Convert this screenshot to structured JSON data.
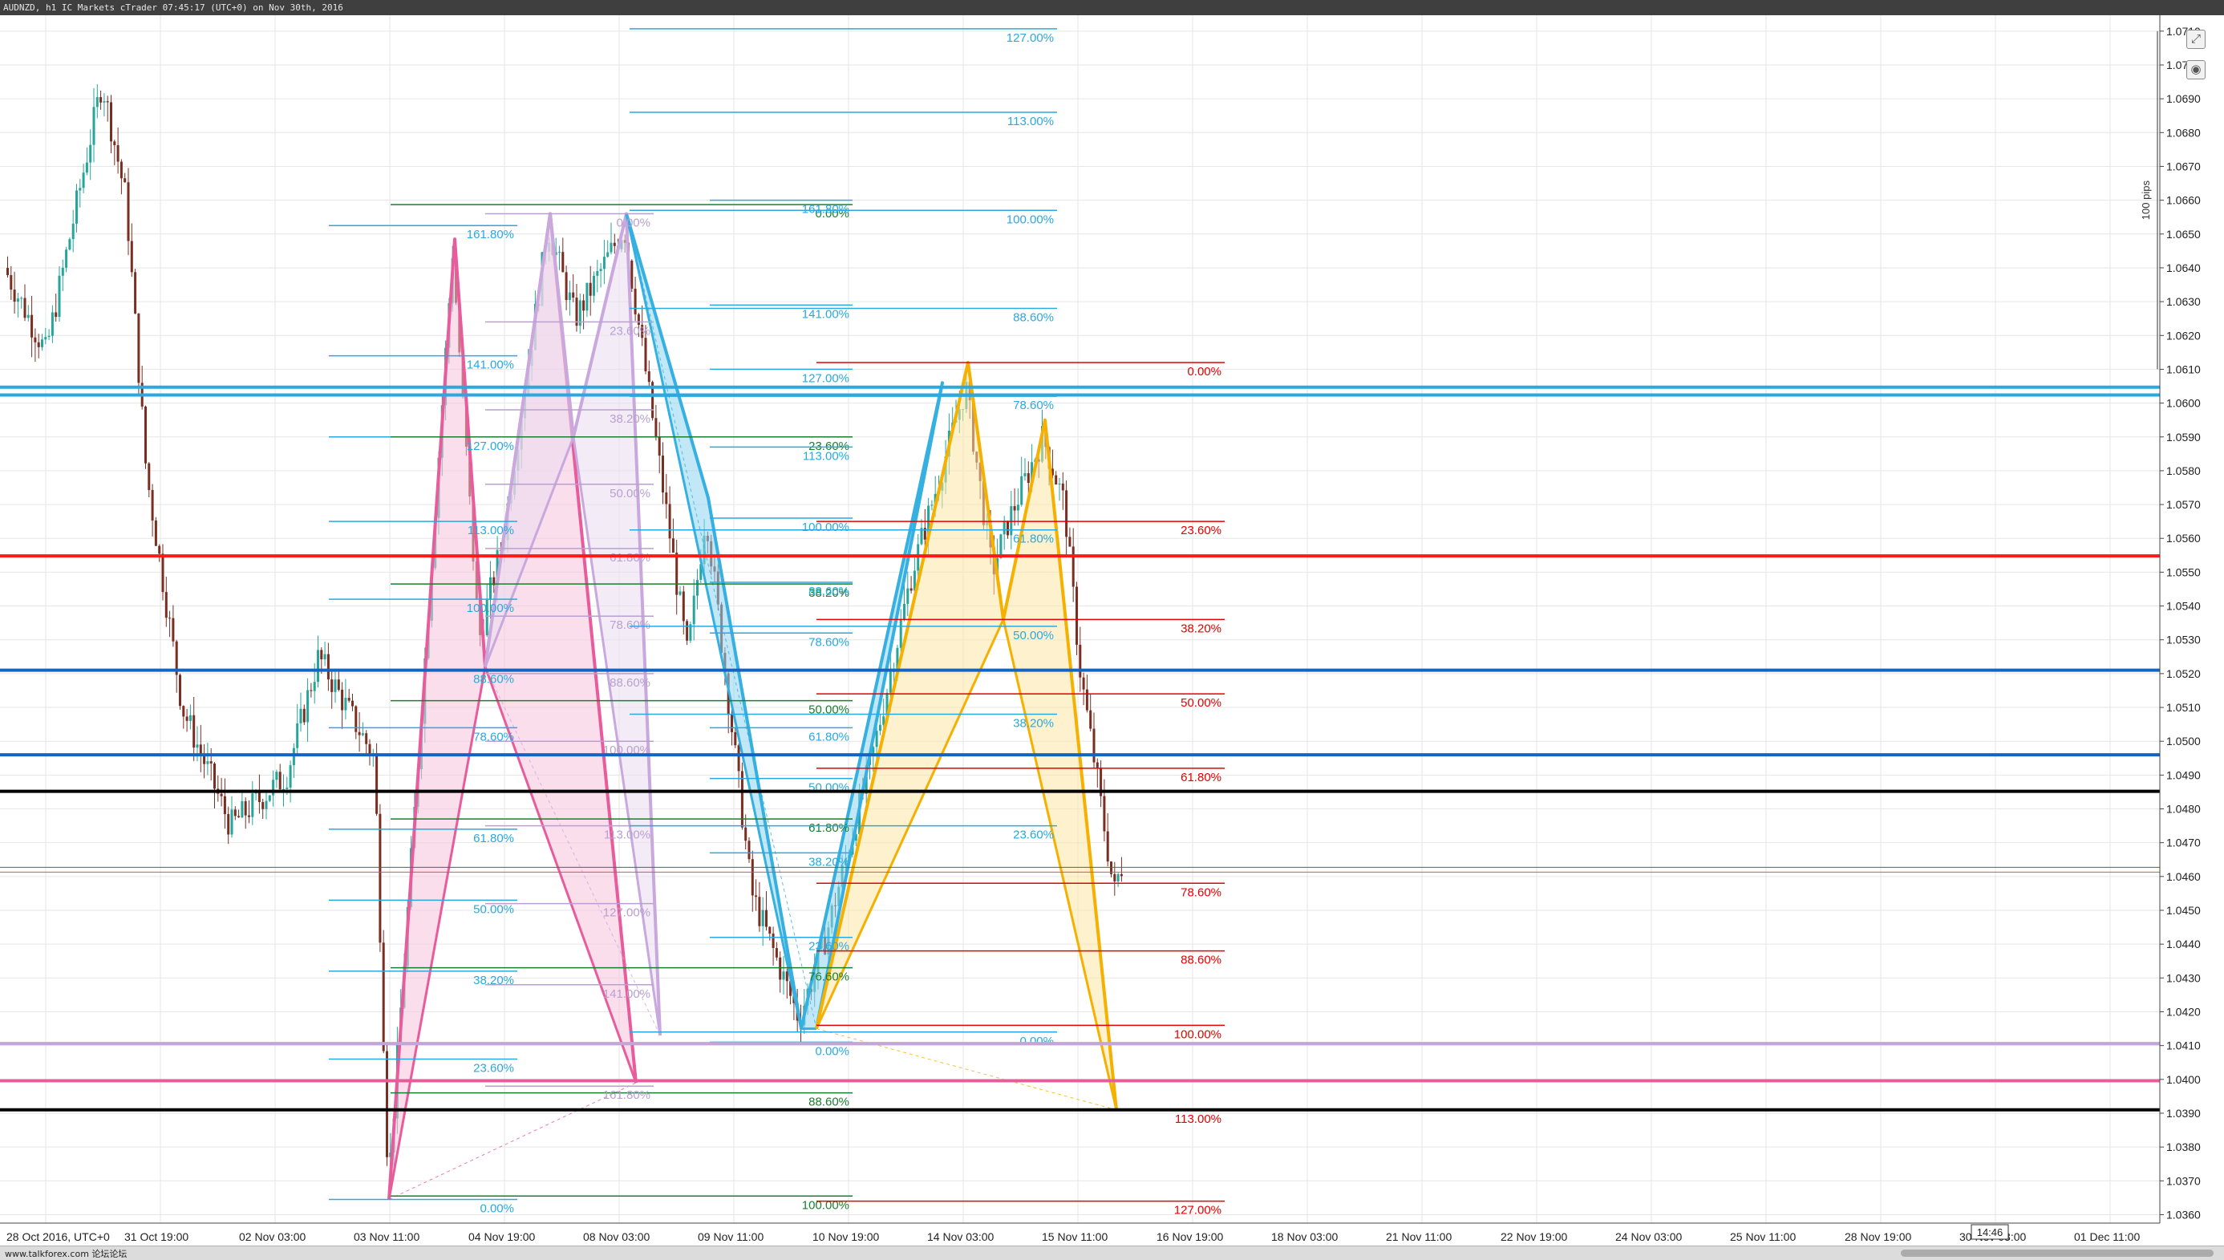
{
  "window": {
    "title": "AUDNZD, h1 IC Markets cTrader 07:45:17 (UTC+0) on Nov 30th, 2016"
  },
  "footer": {
    "brand": "www.talkforex.com 论坛论坛"
  },
  "toolbar": {
    "popout_icon": "popout-icon",
    "camera_icon": "camera-icon"
  },
  "chart": {
    "symbol": "AUDNZD",
    "timeframe": "h1",
    "pips_ruler": "100 pips",
    "cursor_time": "14:46",
    "colors": {
      "up": "#26a69a",
      "down": "#7a2e22",
      "background": "#ffffff",
      "grid": "#e6e6e6",
      "pink": "#e85c9c",
      "lilac": "#c3a5d6",
      "blue": "#2ba3d6",
      "orange": "#f5b000"
    }
  },
  "chart_data": {
    "type": "candlestick",
    "price_axis": {
      "ticks": [
        "1.0710",
        "1.0700",
        "1.0690",
        "1.0680",
        "1.0670",
        "1.0660",
        "1.0650",
        "1.0640",
        "1.0630",
        "1.0620",
        "1.0610",
        "1.0600",
        "1.0590",
        "1.0580",
        "1.0570",
        "1.0560",
        "1.0550",
        "1.0540",
        "1.0530",
        "1.0520",
        "1.0510",
        "1.0500",
        "1.0490",
        "1.0480",
        "1.0470",
        "1.0460",
        "1.0450",
        "1.0440",
        "1.0430",
        "1.0420",
        "1.0410",
        "1.0400",
        "1.0390",
        "1.0380",
        "1.0370",
        "1.0360"
      ],
      "range": [
        1.03575,
        1.07147
      ]
    },
    "time_axis": {
      "labels": [
        "28 Oct 2016, UTC+0",
        "31 Oct 19:00",
        "02 Nov 03:00",
        "03 Nov 11:00",
        "04 Nov 19:00",
        "08 Nov 03:00",
        "09 Nov 11:00",
        "10 Nov 19:00",
        "14 Nov 03:00",
        "15 Nov 11:00",
        "16 Nov 19:00",
        "18 Nov 03:00",
        "21 Nov 11:00",
        "22 Nov 19:00",
        "24 Nov 03:00",
        "25 Nov 11:00",
        "28 Nov 19:00",
        "30 Nov 03:00",
        "01 Dec 11:00"
      ]
    },
    "horizontal_levels": [
      {
        "price": 1.06047,
        "label": "1.06047",
        "color": "#29a9e0"
      },
      {
        "price": 1.06024,
        "label": "1.06024",
        "color": "#29a9e0"
      },
      {
        "price": 1.05548,
        "label": "1.05548",
        "color": "#ff1a1a"
      },
      {
        "price": 1.0521,
        "label": "1.05210",
        "color": "#1565c0"
      },
      {
        "price": 1.0496,
        "label": "1.04960",
        "color": "#1565c0"
      },
      {
        "price": 1.04852,
        "label": "1.04852",
        "color": "#000000"
      },
      {
        "price": 1.04106,
        "label": "1.04106",
        "color": "#c3a5d6"
      },
      {
        "price": 1.03996,
        "label": "1.03996",
        "color": "#e85c9c"
      },
      {
        "price": 1.0391,
        "label": "1.03910",
        "color": "#000000"
      }
    ],
    "current_price": {
      "bid": "1.04613",
      "bid_color": "#d9534f",
      "ask_color": "#2e7d32"
    },
    "fib_sets": [
      {
        "name": "fib-blue-1",
        "color": "#29a9e0",
        "x_range": [
          410,
          645
        ],
        "levels": [
          {
            "label": "161.80%",
            "price": 1.06525
          },
          {
            "label": "141.00%",
            "price": 1.0614
          },
          {
            "label": "127.00%",
            "price": 1.059
          },
          {
            "label": "113.00%",
            "price": 1.0565
          },
          {
            "label": "100.00%",
            "price": 1.0542
          },
          {
            "label": "88.60%",
            "price": 1.0521
          },
          {
            "label": "78.60%",
            "price": 1.0504
          },
          {
            "label": "61.80%",
            "price": 1.0474
          },
          {
            "label": "50.00%",
            "price": 1.0453
          },
          {
            "label": "38.20%",
            "price": 1.0432
          },
          {
            "label": "23.60%",
            "price": 1.0406
          },
          {
            "label": "0.00%",
            "price": 1.03645
          }
        ]
      },
      {
        "name": "fib-green-1",
        "color": "#1b7d2f",
        "x_range": [
          487,
          1063
        ],
        "levels": [
          {
            "label": "0.00%",
            "price": 1.06587
          },
          {
            "label": "23.60%",
            "price": 1.059
          },
          {
            "label": "38.20%",
            "price": 1.05465
          },
          {
            "label": "50.00%",
            "price": 1.0512
          },
          {
            "label": "61.80%",
            "price": 1.0477
          },
          {
            "label": "76.60%",
            "price": 1.0433
          },
          {
            "label": "88.60%",
            "price": 1.0396
          },
          {
            "label": "100.00%",
            "price": 1.03655
          }
        ]
      },
      {
        "name": "fib-lilac",
        "color": "#b9a0d0",
        "x_range": [
          605,
          815
        ],
        "levels": [
          {
            "label": "0.00%",
            "price": 1.0656
          },
          {
            "label": "23.60%",
            "price": 1.0624
          },
          {
            "label": "38.20%",
            "price": 1.0598
          },
          {
            "label": "50.00%",
            "price": 1.0576
          },
          {
            "label": "61.80%",
            "price": 1.0557
          },
          {
            "label": "78.60%",
            "price": 1.0537
          },
          {
            "label": "88.60%",
            "price": 1.052
          },
          {
            "label": "100.00%",
            "price": 1.05
          },
          {
            "label": "113.00%",
            "price": 1.0475
          },
          {
            "label": "127.00%",
            "price": 1.0452
          },
          {
            "label": "141.00%",
            "price": 1.0428
          },
          {
            "label": "161.80%",
            "price": 1.0398
          }
        ]
      },
      {
        "name": "fib-blue-2",
        "color": "#29a9e0",
        "x_range": [
          885,
          1063
        ],
        "levels": [
          {
            "label": "161.80%",
            "price": 1.066
          },
          {
            "label": "141.00%",
            "price": 1.0629
          },
          {
            "label": "127.00%",
            "price": 1.061
          },
          {
            "label": "113.00%",
            "price": 1.0587
          },
          {
            "label": "100.00%",
            "price": 1.0566
          },
          {
            "label": "88.60%",
            "price": 1.0547
          },
          {
            "label": "78.60%",
            "price": 1.0532
          },
          {
            "label": "61.80%",
            "price": 1.0504
          },
          {
            "label": "50.00%",
            "price": 1.0489
          },
          {
            "label": "38.20%",
            "price": 1.0467
          },
          {
            "label": "23.60%",
            "price": 1.0442
          },
          {
            "label": "0.00%",
            "price": 1.0411
          }
        ]
      },
      {
        "name": "fib-red",
        "color": "#e60000",
        "x_range": [
          1018,
          1527
        ],
        "levels": [
          {
            "label": "0.00%",
            "price": 1.0612
          },
          {
            "label": "23.60%",
            "price": 1.0565
          },
          {
            "label": "38.20%",
            "price": 1.0536
          },
          {
            "label": "50.00%",
            "price": 1.0514
          },
          {
            "label": "61.80%",
            "price": 1.0492
          },
          {
            "label": "78.60%",
            "price": 1.0458
          },
          {
            "label": "88.60%",
            "price": 1.0438
          },
          {
            "label": "100.00%",
            "price": 1.0416
          },
          {
            "label": "113.00%",
            "price": 1.0391
          },
          {
            "label": "127.00%",
            "price": 1.0364
          }
        ]
      },
      {
        "name": "fib-blue-3",
        "color": "#29a9e0",
        "x_range": [
          785,
          1318
        ],
        "levels": [
          {
            "label": "127.00%",
            "price": 1.07107
          },
          {
            "label": "113.00%",
            "price": 1.0686
          },
          {
            "label": "100.00%",
            "price": 1.0657
          },
          {
            "label": "88.60%",
            "price": 1.0628
          },
          {
            "label": "78.60%",
            "price": 1.0602
          },
          {
            "label": "61.80%",
            "price": 1.05625
          },
          {
            "label": "50.00%",
            "price": 1.0534
          },
          {
            "label": "38.20%",
            "price": 1.0508
          },
          {
            "label": "23.60%",
            "price": 1.0475
          },
          {
            "label": "0.00%",
            "price": 1.0414
          }
        ]
      }
    ],
    "patterns": [
      {
        "name": "pink-pattern",
        "stroke": "#e85c9c",
        "fill": "#f5c2da",
        "points": [
          [
            485,
            1.03645
          ],
          [
            567,
            1.06485
          ],
          [
            605,
            1.0522
          ],
          [
            686,
            1.0656
          ],
          [
            793,
            1.0399
          ]
        ]
      },
      {
        "name": "lilac-pattern",
        "stroke": "#c9a8de",
        "fill": "#e9dcf0",
        "points": [
          [
            605,
            1.0522
          ],
          [
            686,
            1.0656
          ],
          [
            715,
            1.059
          ],
          [
            781,
            1.0656
          ],
          [
            823,
            1.0413
          ]
        ]
      },
      {
        "name": "blue-pattern",
        "stroke": "#35b0e0",
        "fill": "#8fd3f0",
        "points": [
          [
            781,
            1.0656
          ],
          [
            883,
            1.0572
          ],
          [
            999,
            1.0415
          ],
          [
            1175,
            1.0606
          ],
          [
            1018,
            1.0415
          ]
        ]
      },
      {
        "name": "orange-pattern",
        "stroke": "#f5b000",
        "fill": "#fde5a6",
        "points": [
          [
            1018,
            1.0415
          ],
          [
            1207,
            1.0612
          ],
          [
            1251,
            1.0536
          ],
          [
            1303,
            1.0595
          ],
          [
            1392,
            1.0391
          ]
        ]
      }
    ]
  }
}
